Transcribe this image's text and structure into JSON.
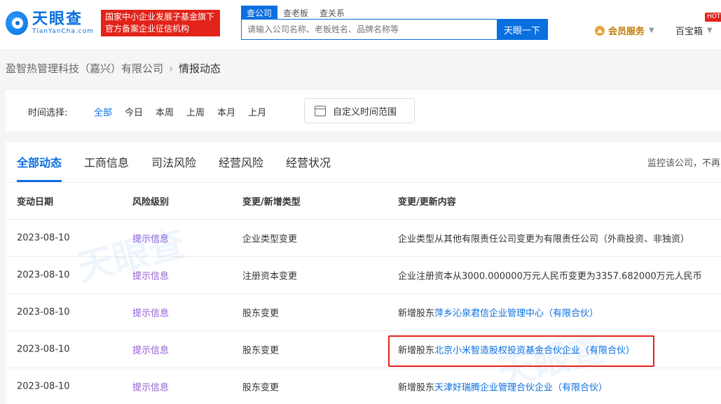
{
  "header": {
    "logo_cn": "天眼查",
    "logo_en": "TianYanCha.com",
    "badge_line1": "国家中小企业发展子基金旗下",
    "badge_line2": "官方备案企业征信机构",
    "search_tabs": [
      "查公司",
      "查老板",
      "查关系"
    ],
    "search_placeholder": "请输入公司名称、老板姓名、品牌名称等",
    "search_button": "天眼一下",
    "member_label": "会员服务",
    "baibox_label": "百宝箱",
    "hot_label": "HOT"
  },
  "breadcrumb": {
    "company": "盈智热管理科技（嘉兴）有限公司",
    "separator": "›",
    "current": "情报动态"
  },
  "filter": {
    "label": "时间选择:",
    "options": [
      "全部",
      "今日",
      "本周",
      "上周",
      "本月",
      "上月"
    ],
    "custom_range": "自定义时间范围"
  },
  "tabs": {
    "items": [
      "全部动态",
      "工商信息",
      "司法风险",
      "经营风险",
      "经营状况"
    ],
    "monitor_text": "监控该公司，不再"
  },
  "table": {
    "headers": [
      "变动日期",
      "风险级别",
      "变更/新增类型",
      "变更/更新内容"
    ],
    "rows": [
      {
        "date": "2023-08-10",
        "risk": "提示信息",
        "type": "企业类型变更",
        "content_prefix": "企业类型从其他有限责任公司变更为有限责任公司（外商投资、非独资）",
        "content_link": ""
      },
      {
        "date": "2023-08-10",
        "risk": "提示信息",
        "type": "注册资本变更",
        "content_prefix": "企业注册资本从3000.000000万元人民币变更为3357.682000万元人民币",
        "content_link": ""
      },
      {
        "date": "2023-08-10",
        "risk": "提示信息",
        "type": "股东变更",
        "content_prefix": "新增股东",
        "content_link": "萍乡沁泉君信企业管理中心（有限合伙）"
      },
      {
        "date": "2023-08-10",
        "risk": "提示信息",
        "type": "股东变更",
        "content_prefix": "新增股东",
        "content_link": "北京小米智造股权投资基金合伙企业（有限合伙）"
      },
      {
        "date": "2023-08-10",
        "risk": "提示信息",
        "type": "股东变更",
        "content_prefix": "新增股东",
        "content_link": "天津好瑞腾企业管理合伙企业（有限合伙）"
      }
    ]
  },
  "colors": {
    "brand_blue": "#0a6fe0",
    "risk_purple": "#8f5bd1",
    "highlight_red": "#e2231a"
  }
}
